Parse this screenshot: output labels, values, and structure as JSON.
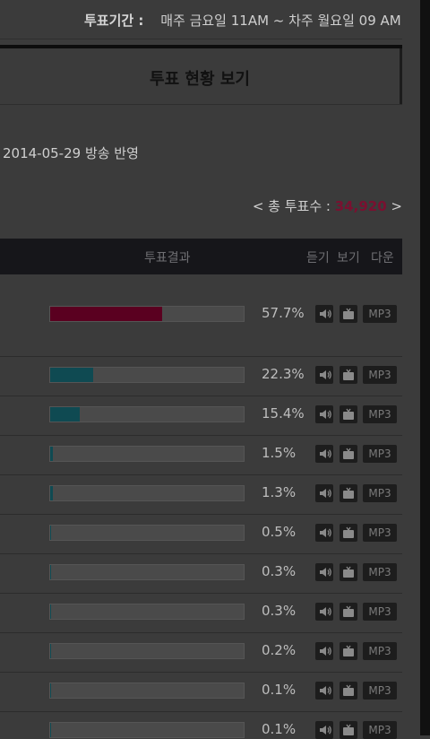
{
  "period": {
    "label": "투표기간 :",
    "value": "매주 금요일 11AM ~ 차주 월요일 09 AM"
  },
  "panel": {
    "title": "투표 현황 보기"
  },
  "broadcast": "2014-05-29 방송 반영",
  "total": {
    "prefix": "< 총 투표수 :",
    "value": "34,920",
    "suffix": ">"
  },
  "table": {
    "result_header": "투표결과",
    "listen_header": "듣기",
    "view_header": "보기",
    "download_header": "다운"
  },
  "colors": {
    "top_bar": "#5a0020",
    "teal_bar": "#0f4a52"
  },
  "rows": [
    {
      "percent_text": "57.7%",
      "fill": 0.577,
      "mp3": "MP3"
    },
    {
      "percent_text": "22.3%",
      "fill": 0.223,
      "mp3": "MP3"
    },
    {
      "percent_text": "15.4%",
      "fill": 0.154,
      "mp3": "MP3"
    },
    {
      "percent_text": "1.5%",
      "fill": 0.015,
      "mp3": "MP3"
    },
    {
      "percent_text": "1.3%",
      "fill": 0.013,
      "mp3": "MP3"
    },
    {
      "percent_text": "0.5%",
      "fill": 0.005,
      "mp3": "MP3"
    },
    {
      "percent_text": "0.3%",
      "fill": 0.003,
      "mp3": "MP3"
    },
    {
      "percent_text": "0.3%",
      "fill": 0.003,
      "mp3": "MP3"
    },
    {
      "percent_text": "0.2%",
      "fill": 0.002,
      "mp3": "MP3"
    },
    {
      "percent_text": "0.1%",
      "fill": 0.001,
      "mp3": "MP3"
    },
    {
      "percent_text": "0.1%",
      "fill": 0.001,
      "mp3": "MP3"
    }
  ]
}
